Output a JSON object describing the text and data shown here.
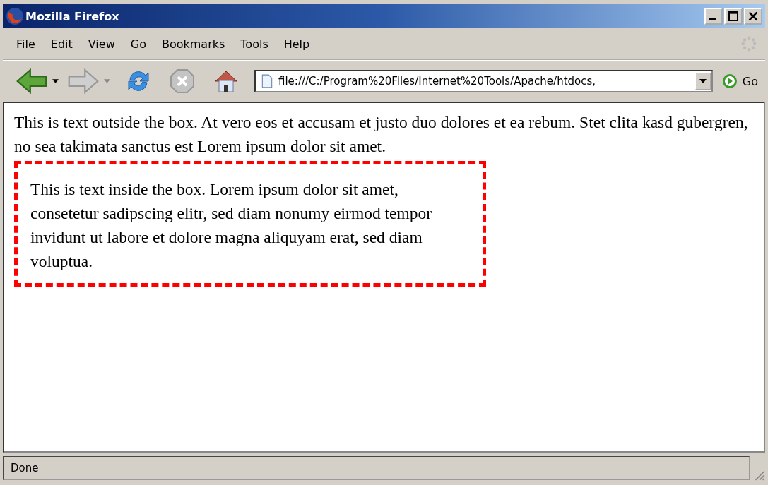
{
  "window": {
    "title": "Mozilla Firefox"
  },
  "menu": [
    "File",
    "Edit",
    "View",
    "Go",
    "Bookmarks",
    "Tools",
    "Help"
  ],
  "address_bar": {
    "value": "file:///C:/Program%20Files/Internet%20Tools/Apache/htdocs,"
  },
  "go_button": {
    "label": "Go"
  },
  "content": {
    "outside_text": "This is text outside the box. At vero eos et accusam et justo duo dolores et ea rebum. Stet clita kasd gubergren, no sea takimata sanctus est Lorem ipsum dolor sit amet.",
    "box_text": "This is text inside the box. Lorem ipsum dolor sit amet, consetetur sadipscing elitr, sed diam nonumy eirmod tempor invidunt ut labore et dolore magna aliquyam erat, sed diam voluptua."
  },
  "status_bar": {
    "text": "Done"
  }
}
